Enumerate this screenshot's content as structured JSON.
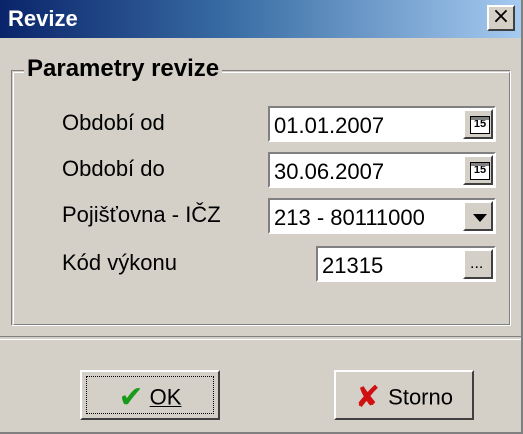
{
  "window": {
    "title": "Revize",
    "close_label": "×"
  },
  "group": {
    "legend": "Parametry revize"
  },
  "fields": {
    "obdobi_od": {
      "label": "Období od",
      "value": "01.01.2007",
      "button_icon": "calendar-icon",
      "button_text": "15"
    },
    "obdobi_do": {
      "label": "Období do",
      "value": "30.06.2007",
      "button_icon": "calendar-icon",
      "button_text": "15"
    },
    "pojistovna": {
      "label": "Pojišťovna - IČZ",
      "value": "213 - 80111000",
      "button_icon": "dropdown-arrow-icon"
    },
    "kod_vykonu": {
      "label": "Kód výkonu",
      "value": "21315",
      "button_text": "..."
    }
  },
  "buttons": {
    "ok": {
      "label": "OK",
      "icon": "checkmark-icon",
      "icon_color": "#1a9a1a"
    },
    "storno": {
      "label": "Storno",
      "icon": "x-mark-icon",
      "icon_color": "#d01010"
    }
  },
  "colors": {
    "title_gradient_start": "#0a246a",
    "title_gradient_end": "#a6caf0",
    "window_bg": "#d4d0c8"
  }
}
